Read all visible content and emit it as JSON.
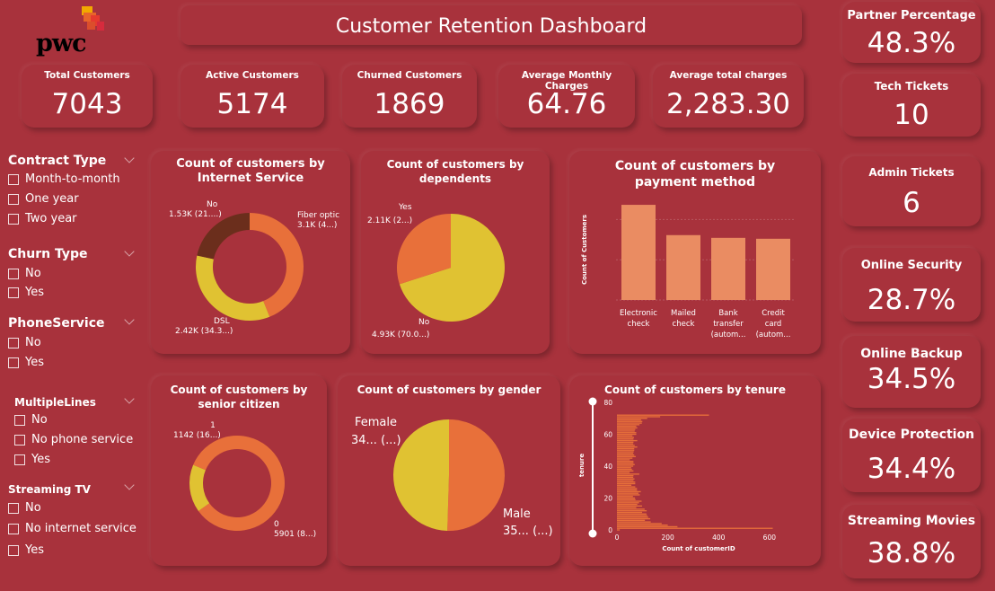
{
  "header": {
    "title": "Customer Retention Dashboard",
    "logo_text": "pwc"
  },
  "kpis": [
    {
      "label": "Total Customers",
      "value": "7043"
    },
    {
      "label": "Active Customers",
      "value": "5174"
    },
    {
      "label": "Churned Customers",
      "value": "1869"
    },
    {
      "label": "Average Monthly Charges",
      "value": "64.76"
    },
    {
      "label": "Average total charges",
      "value": "2,283.30"
    }
  ],
  "side_kpis": [
    {
      "label": "Partner Percentage",
      "value": "48.3%"
    },
    {
      "label": "Tech Tickets",
      "value": "10"
    },
    {
      "label": "Admin Tickets",
      "value": "6"
    },
    {
      "label": "Online Security",
      "value": "28.7%"
    },
    {
      "label": "Online Backup",
      "value": "34.5%"
    },
    {
      "label": "Device Protection",
      "value": "34.4%"
    },
    {
      "label": "Streaming Movies",
      "value": "38.8%"
    }
  ],
  "filters": [
    {
      "title": "Contract Type",
      "options": [
        "Month-to-month",
        "One year",
        "Two year"
      ]
    },
    {
      "title": "Churn Type",
      "options": [
        "No",
        "Yes"
      ]
    },
    {
      "title": "PhoneService",
      "options": [
        "No",
        "Yes"
      ]
    },
    {
      "title": "MultipleLines",
      "options": [
        "No",
        "No phone service",
        "Yes"
      ]
    },
    {
      "title": "Streaming TV",
      "options": [
        "No",
        "No internet service",
        "Yes"
      ]
    }
  ],
  "colors": {
    "background": "#a8323c",
    "orange": "#e8703a",
    "yellow": "#e0c232",
    "brown": "#6b2e1c",
    "bar": "#ea8c62"
  },
  "chart_data": [
    {
      "type": "donut",
      "title": "Count of customers by Internet Service",
      "slices": [
        {
          "label": "Fiber optic",
          "value": 3096,
          "data_label_name": "Fiber optic",
          "data_label_value": "3.1K (4...)",
          "color": "#e8703a"
        },
        {
          "label": "DSL",
          "value": 2421,
          "data_label_name": "DSL",
          "data_label_value": "2.42K (34.3...)",
          "color": "#e0c232"
        },
        {
          "label": "No",
          "value": 1526,
          "data_label_name": "No",
          "data_label_value": "1.53K (21....)",
          "color": "#6b2e1c"
        }
      ]
    },
    {
      "type": "pie",
      "title": "Count of customers by dependents",
      "slices": [
        {
          "label": "No",
          "value": 4933,
          "data_label_name": "No",
          "data_label_value": "4.93K (70.0...)",
          "color": "#e0c232"
        },
        {
          "label": "Yes",
          "value": 2110,
          "data_label_name": "Yes",
          "data_label_value": "2.11K (2...)",
          "color": "#e8703a"
        }
      ]
    },
    {
      "type": "bar",
      "title": "Count of customers by payment method",
      "ylabel": "Count of Customers",
      "categories": [
        [
          "Electronic",
          "check"
        ],
        [
          "Mailed",
          "check"
        ],
        [
          "Bank",
          "transfer",
          "(autom..."
        ],
        [
          "Credit",
          "card",
          "(autom..."
        ]
      ],
      "values": [
        2365,
        1612,
        1544,
        1522
      ],
      "ylim": [
        0,
        2500
      ]
    },
    {
      "type": "donut",
      "title": "Count of customers by senior citizen",
      "slices": [
        {
          "label": "0",
          "value": 5901,
          "data_label_name": "0",
          "data_label_value": "5901 (8...)",
          "color": "#e8703a"
        },
        {
          "label": "1",
          "value": 1142,
          "data_label_name": "1",
          "data_label_value": "1142 (16...)",
          "color": "#e0c232"
        }
      ]
    },
    {
      "type": "pie",
      "title": "Count of customers by gender",
      "slices": [
        {
          "label": "Male",
          "value": 3555,
          "data_label_name": "Male",
          "data_label_value": "35... (...)",
          "color": "#e8703a"
        },
        {
          "label": "Female",
          "value": 3488,
          "data_label_name": "Female",
          "data_label_value": "34... (...)",
          "color": "#e0c232"
        }
      ]
    },
    {
      "type": "bar",
      "orientation": "horizontal",
      "title": "Count of customers by tenure",
      "xlabel": "Count of customerID",
      "ylabel": "tenure",
      "xlim": [
        0,
        650
      ],
      "ylim": [
        0,
        80
      ],
      "x_ticks": [
        0,
        200,
        400,
        600
      ],
      "y_ticks": [
        0,
        20,
        40,
        60,
        80
      ],
      "tenure": [
        0,
        1,
        2,
        3,
        4,
        5,
        6,
        7,
        8,
        9,
        10,
        11,
        12,
        13,
        14,
        15,
        16,
        17,
        18,
        19,
        20,
        21,
        22,
        23,
        24,
        25,
        26,
        27,
        28,
        29,
        30,
        31,
        32,
        33,
        34,
        35,
        36,
        37,
        38,
        39,
        40,
        41,
        42,
        43,
        44,
        45,
        46,
        47,
        48,
        49,
        50,
        51,
        52,
        53,
        54,
        55,
        56,
        57,
        58,
        59,
        60,
        61,
        62,
        63,
        64,
        65,
        66,
        67,
        68,
        69,
        70,
        71,
        72
      ],
      "values": [
        11,
        613,
        238,
        200,
        176,
        133,
        110,
        131,
        123,
        119,
        116,
        99,
        117,
        109,
        76,
        99,
        80,
        87,
        97,
        73,
        71,
        63,
        90,
        85,
        94,
        79,
        79,
        72,
        57,
        72,
        72,
        65,
        69,
        64,
        65,
        88,
        50,
        65,
        59,
        56,
        64,
        70,
        65,
        65,
        51,
        61,
        74,
        68,
        64,
        66,
        68,
        68,
        80,
        70,
        64,
        65,
        80,
        65,
        67,
        61,
        76,
        76,
        70,
        72,
        80,
        76,
        89,
        98,
        100,
        95,
        119,
        170,
        362
      ]
    }
  ]
}
